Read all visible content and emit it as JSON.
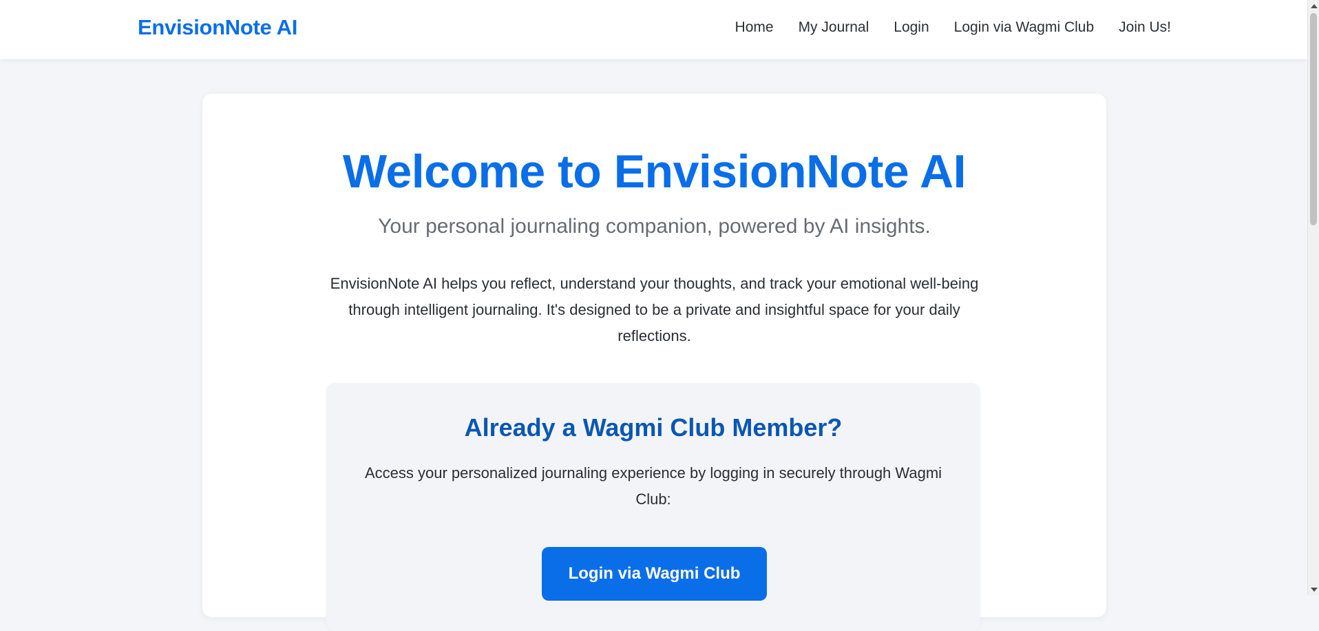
{
  "brand": {
    "name": "EnvisionNote AI"
  },
  "nav": {
    "items": [
      {
        "label": "Home"
      },
      {
        "label": "My Journal"
      },
      {
        "label": "Login"
      },
      {
        "label": "Login via Wagmi Club"
      },
      {
        "label": "Join Us!"
      }
    ]
  },
  "hero": {
    "title": "Welcome to EnvisionNote AI",
    "subtitle": "Your personal journaling companion, powered by AI insights.",
    "description": "EnvisionNote AI helps you reflect, understand your thoughts, and track your emotional well-being through intelligent journaling. It's designed to be a private and insightful space for your daily reflections."
  },
  "member": {
    "title": "Already a Wagmi Club Member?",
    "text": "Access your personalized journaling experience by logging in securely through Wagmi Club:",
    "button_label": "Login via Wagmi Club"
  },
  "colors": {
    "accent": "#0a6ee8",
    "accent_dark": "#0957b3",
    "page_background": "#f4f5f8",
    "card_background": "#ffffff"
  }
}
